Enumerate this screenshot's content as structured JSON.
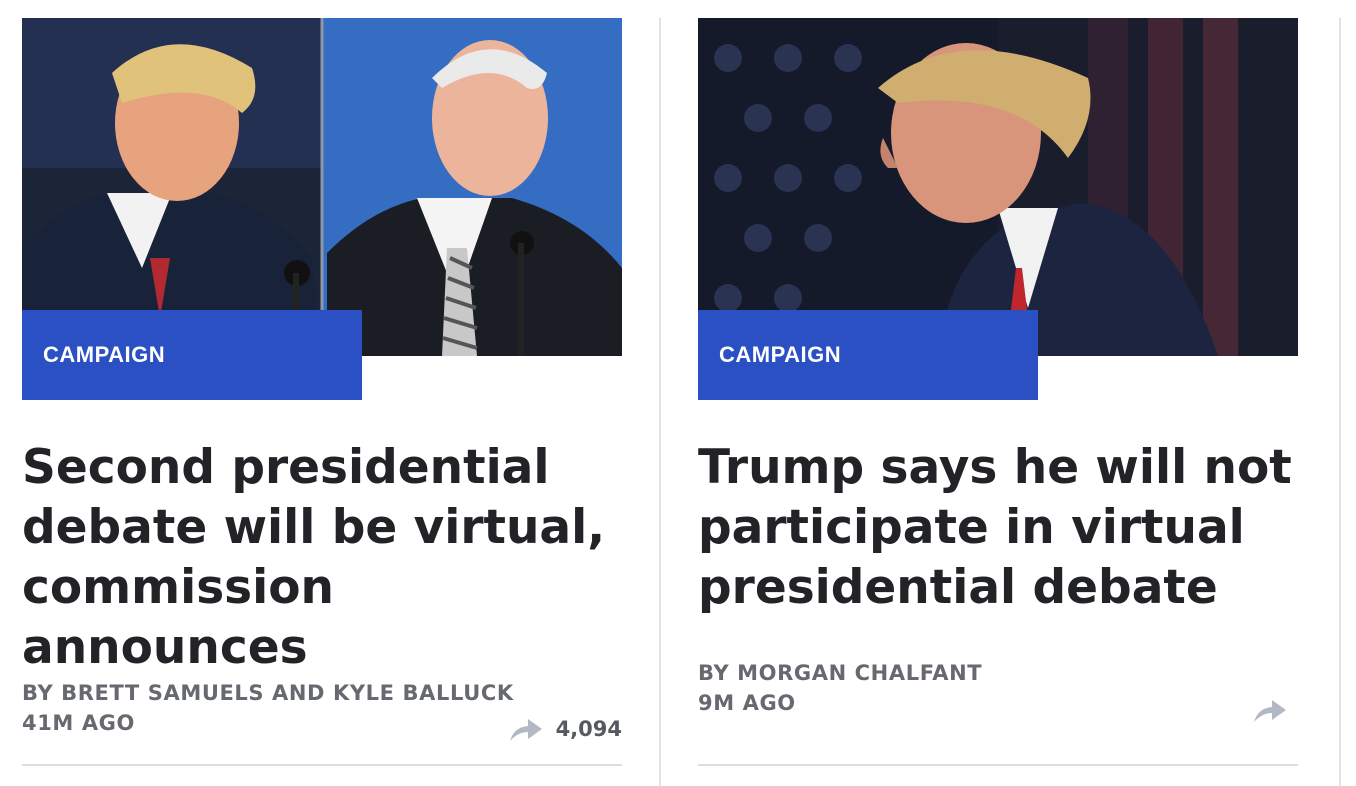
{
  "articles": [
    {
      "category": "CAMPAIGN",
      "headline": "Second presidential debate will be virtual, commission announces",
      "byline": "BY BRETT SAMUELS AND KYLE BALLUCK",
      "time": "41M AGO",
      "share_count": "4,094",
      "image_subject": "trump-and-biden-debate-photo"
    },
    {
      "category": "CAMPAIGN",
      "headline": "Trump says he will not participate in virtual presidential debate",
      "byline": "BY MORGAN CHALFANT",
      "time": "9M AGO",
      "share_count": "",
      "image_subject": "trump-profile-photo"
    }
  ],
  "icons": {
    "share": "share-arrow-icon"
  },
  "colors": {
    "tag_background": "#2b50c4",
    "headline": "#222326",
    "meta": "#666a70",
    "share_icon": "#b3b9c4"
  }
}
